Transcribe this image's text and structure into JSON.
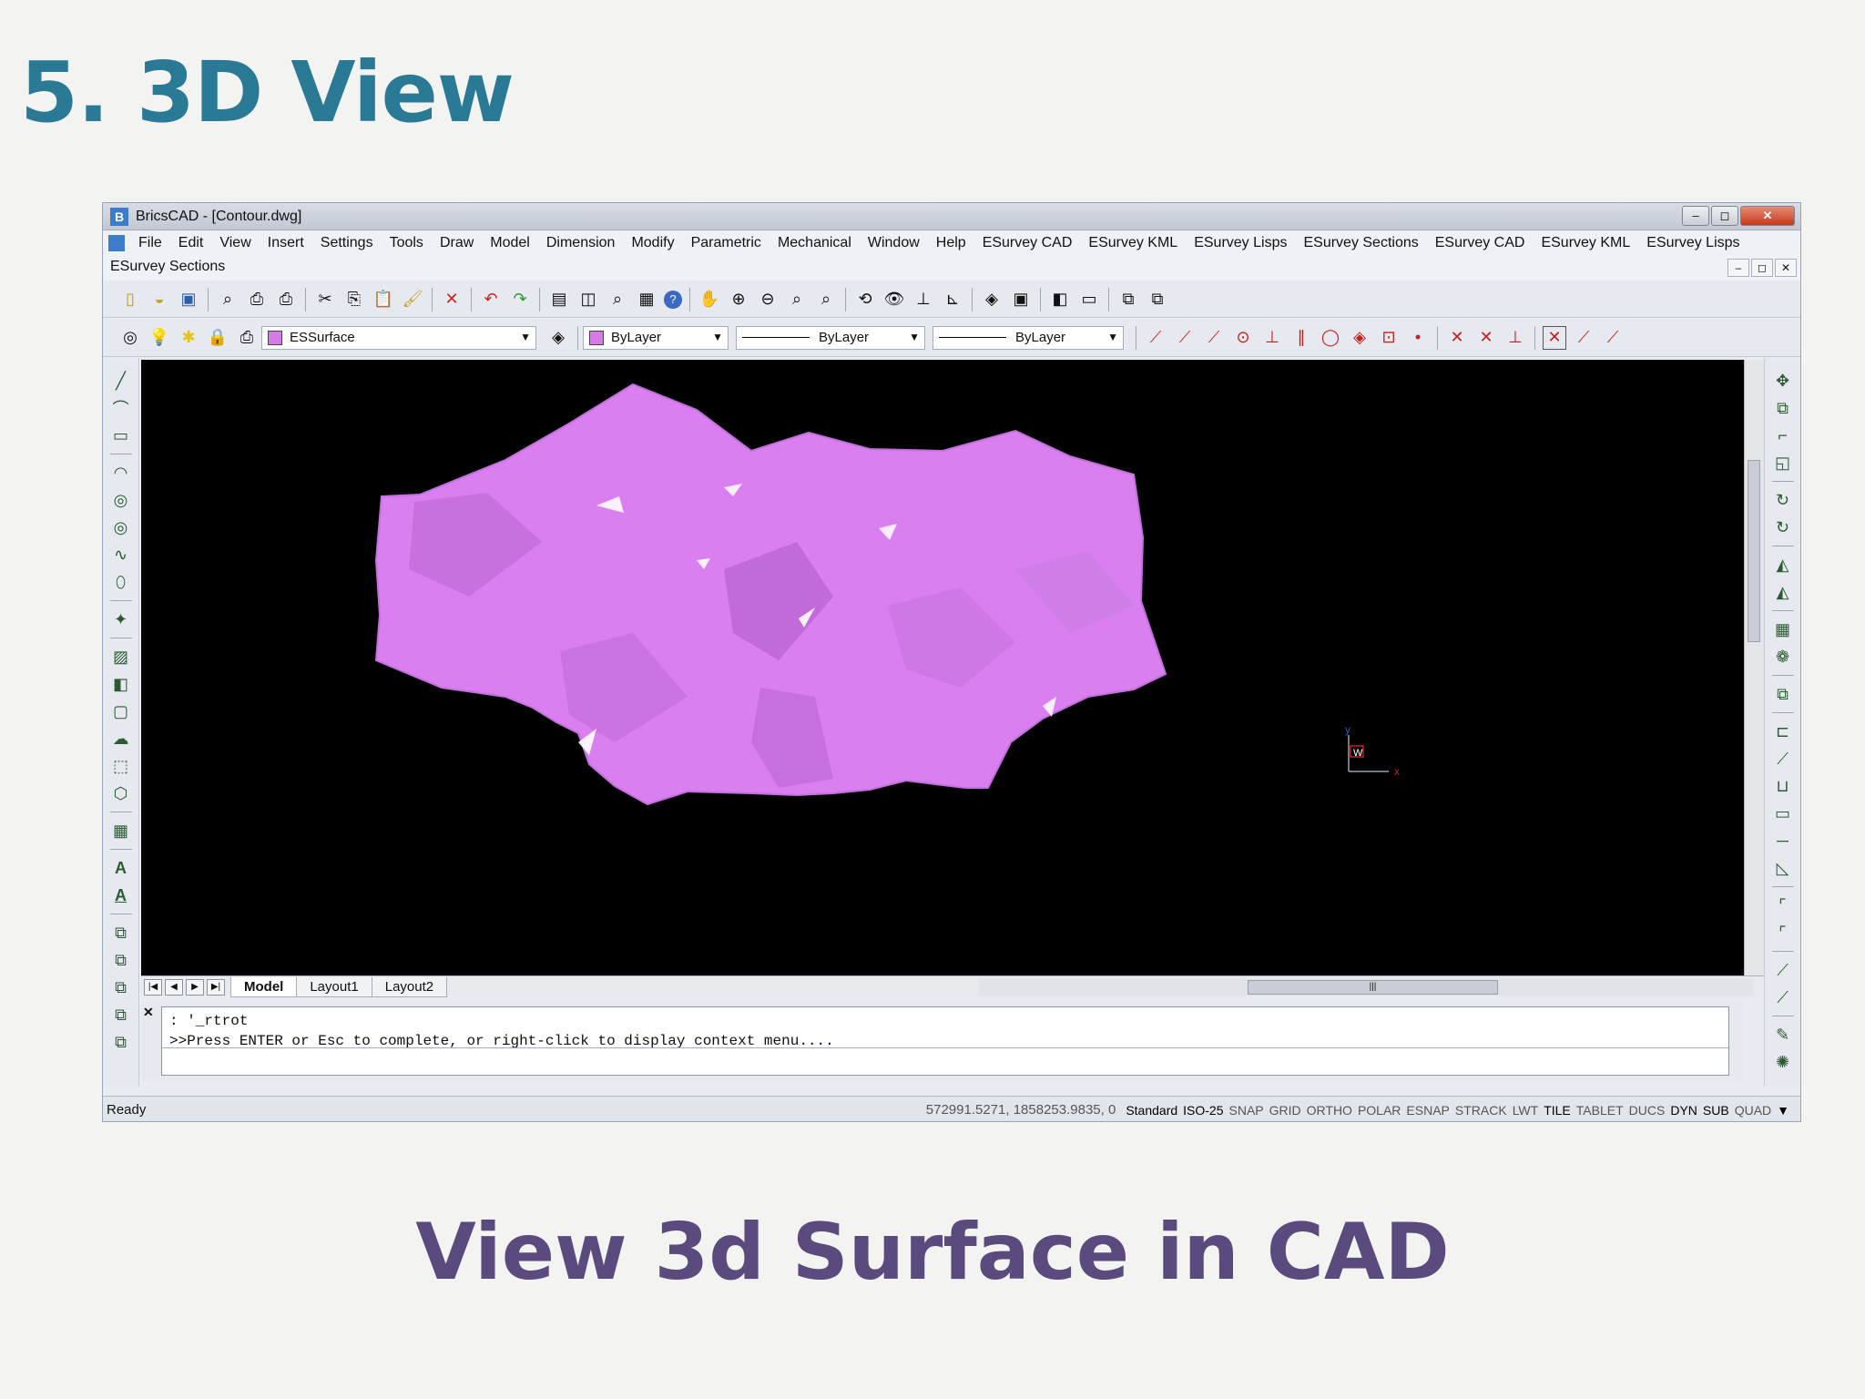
{
  "slide": {
    "title": "5. 3D View",
    "caption": "View 3d Surface in CAD"
  },
  "window": {
    "title": "BricsCAD - [Contour.dwg]",
    "controls": [
      "–",
      "◻",
      "✕"
    ]
  },
  "menu": {
    "items": [
      "File",
      "Edit",
      "View",
      "Insert",
      "Settings",
      "Tools",
      "Draw",
      "Model",
      "Dimension",
      "Modify",
      "Parametric",
      "Mechanical",
      "Window",
      "Help",
      "ESurvey CAD",
      "ESurvey KML",
      "ESurvey Lisps",
      "ESurvey Sections",
      "ESurvey CAD",
      "ESurvey KML",
      "ESurvey Lisps"
    ],
    "row2": "ESurvey Sections"
  },
  "props": {
    "layer": "ESSurface",
    "color": "ByLayer",
    "linetype": "ByLayer",
    "lineweight": "ByLayer",
    "color_hex": "#d67ae6"
  },
  "viewport": {
    "surface_color": "#d97ff0",
    "ucs_label": "W"
  },
  "tabs": [
    "Model",
    "Layout1",
    "Layout2"
  ],
  "command": {
    "line1": ": '_rtrot",
    "line2": ">>Press ENTER or Esc to complete, or right-click to display context menu...."
  },
  "status": {
    "ready": "Ready",
    "coords": "572991.5271, 1858253.9835, 0",
    "items": [
      {
        "label": "Standard",
        "on": true
      },
      {
        "label": "ISO-25",
        "on": true
      },
      {
        "label": "SNAP",
        "on": false
      },
      {
        "label": "GRID",
        "on": false
      },
      {
        "label": "ORTHO",
        "on": false
      },
      {
        "label": "POLAR",
        "on": false
      },
      {
        "label": "ESNAP",
        "on": false
      },
      {
        "label": "STRACK",
        "on": false
      },
      {
        "label": "LWT",
        "on": false
      },
      {
        "label": "TILE",
        "on": true
      },
      {
        "label": "TABLET",
        "on": false
      },
      {
        "label": "DUCS",
        "on": false
      },
      {
        "label": "DYN",
        "on": true
      },
      {
        "label": "SUB",
        "on": true
      },
      {
        "label": "QUAD",
        "on": false
      }
    ]
  }
}
